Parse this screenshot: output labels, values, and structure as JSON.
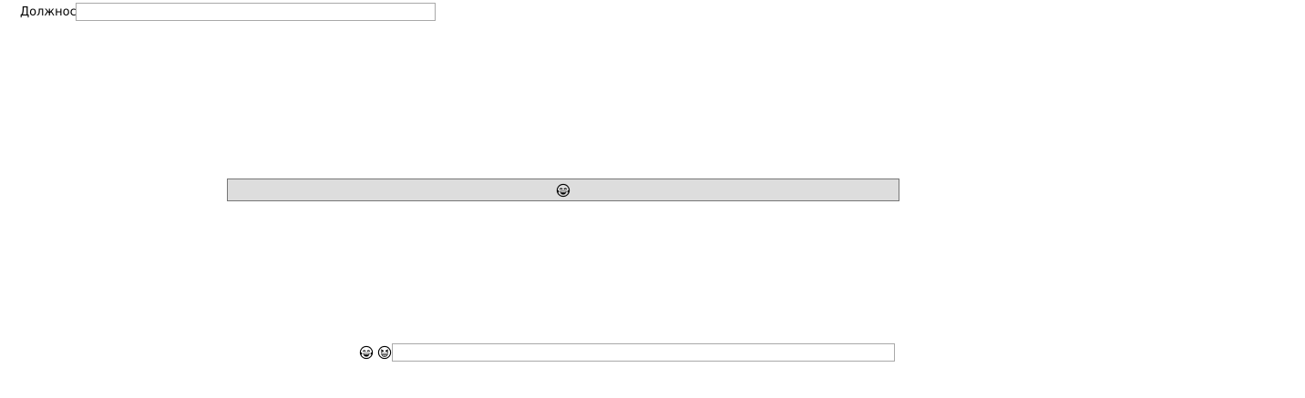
{
  "form": {
    "position_label": "Должность",
    "position_value": "",
    "bottom_value": ""
  },
  "icons": {
    "bar_button_icon": "face-with-tears-of-joy-icon",
    "left_icon": "face-with-tears-of-joy-icon",
    "right_icon": "grinning-squinting-face-icon"
  }
}
